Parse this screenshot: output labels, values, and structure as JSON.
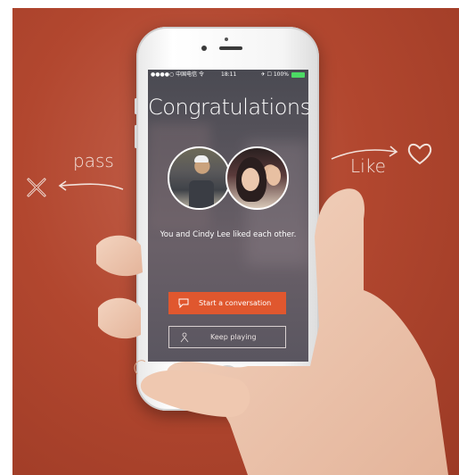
{
  "side_labels": {
    "pass": "pass",
    "like": "Like"
  },
  "icons": {
    "pass": "x-icon",
    "like": "heart-icon",
    "chat": "chat-bubble-icon",
    "keep": "figure-icon"
  },
  "colors": {
    "background": "#b2472f",
    "primary_button": "#e0572e",
    "battery": "#4cd964"
  },
  "status_bar": {
    "carrier": "●●●●○ 中国电信 令",
    "time": "18:11",
    "battery": "✈ ☐ 100%"
  },
  "screen": {
    "title": "Congratulations!",
    "match_message": "You and Cindy Lee liked each other.",
    "primary_button": "Start a conversation",
    "secondary_button": "Keep playing"
  }
}
